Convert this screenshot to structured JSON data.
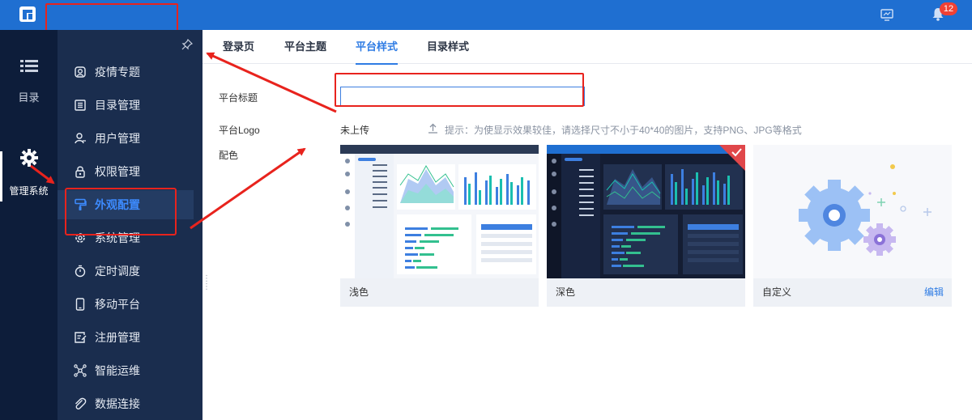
{
  "topbar": {
    "logo": "logo-mark",
    "notification_count": "12",
    "accent_color": "#1f6fd1"
  },
  "rail": {
    "items": [
      {
        "label": "目录",
        "icon": "list-icon"
      },
      {
        "label": "管理系统",
        "icon": "gear-icon"
      }
    ]
  },
  "menu": {
    "items": [
      {
        "label": "疫情专题",
        "icon": "face-icon"
      },
      {
        "label": "目录管理",
        "icon": "catalog-icon"
      },
      {
        "label": "用户管理",
        "icon": "user-icon"
      },
      {
        "label": "权限管理",
        "icon": "lock-icon"
      },
      {
        "label": "外观配置",
        "icon": "brush-icon"
      },
      {
        "label": "系统管理",
        "icon": "gear-icon"
      },
      {
        "label": "定时调度",
        "icon": "timer-icon"
      },
      {
        "label": "移动平台",
        "icon": "mobile-icon"
      },
      {
        "label": "注册管理",
        "icon": "register-icon"
      },
      {
        "label": "智能运维",
        "icon": "network-icon"
      },
      {
        "label": "数据连接",
        "icon": "link-icon"
      }
    ],
    "active_index": 4
  },
  "tabs": [
    {
      "label": "登录页"
    },
    {
      "label": "平台主题"
    },
    {
      "label": "平台样式"
    },
    {
      "label": "目录样式"
    }
  ],
  "active_tab": 2,
  "form": {
    "title_label": "平台标题",
    "title_value": "",
    "logo_label": "平台Logo",
    "upload_text": "未上传",
    "hint": "提示：为使显示效果较佳，请选择尺寸不小于40*40的图片，支持PNG、JPG等格式",
    "color_label": "配色"
  },
  "themes": [
    {
      "name": "浅色",
      "selected": false
    },
    {
      "name": "深色",
      "selected": true
    },
    {
      "name": "自定义",
      "edit_label": "编辑",
      "selected": false
    }
  ]
}
